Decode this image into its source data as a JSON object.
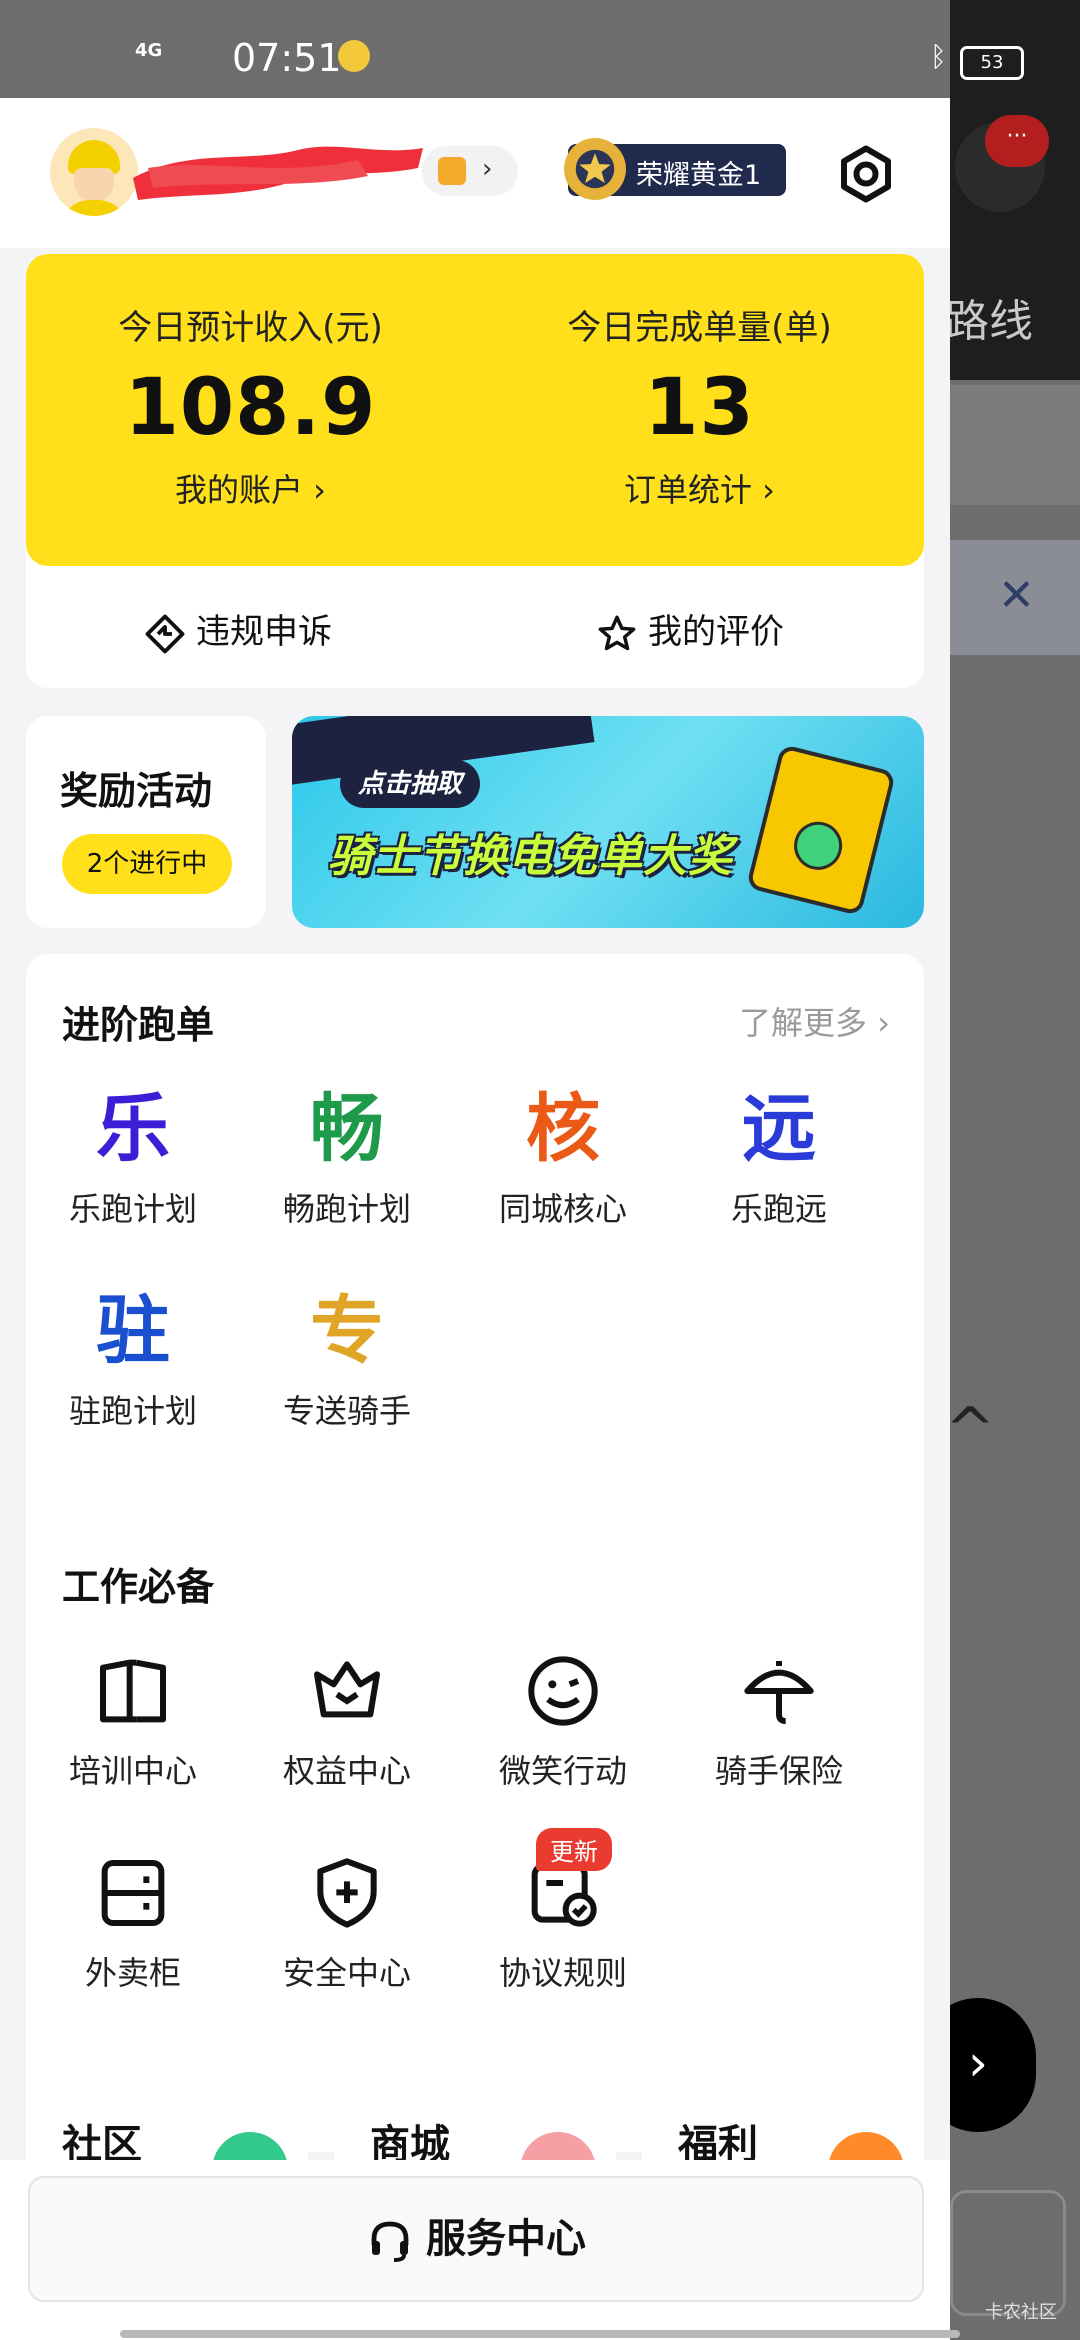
{
  "status_bar": {
    "network": "4G",
    "time": "07:51",
    "battery": "53"
  },
  "background_app": {
    "route_text": "路线",
    "bell_badge": "···",
    "watermark": "卡农社区"
  },
  "profile": {
    "level_badge": "荣耀黄金1"
  },
  "earnings": {
    "income_title": "今日预计收入(元)",
    "income_value": "108.9",
    "income_link": "我的账户 ›",
    "orders_title": "今日完成单量(单)",
    "orders_value": "13",
    "orders_link": "订单统计 ›",
    "appeal_label": "违规申诉",
    "rating_label": "我的评价"
  },
  "rewards": {
    "title": "奖励活动",
    "status": "2个进行中"
  },
  "banner": {
    "chip": "点击抽取",
    "headline": "骑士节换电免单大奖"
  },
  "advanced": {
    "title": "进阶跑单",
    "more": "了解更多 ›",
    "items": [
      {
        "glyph": "乐",
        "label": "乐跑计划",
        "color": "#3a1fd6"
      },
      {
        "glyph": "畅",
        "label": "畅跑计划",
        "color": "#1e9a4a"
      },
      {
        "glyph": "核",
        "label": "同城核心",
        "color": "#ea5a16"
      },
      {
        "glyph": "远",
        "label": "乐跑远",
        "color": "#2a3bd8"
      },
      {
        "glyph": "驻",
        "label": "驻跑计划",
        "color": "#1a4fd0"
      },
      {
        "glyph": "专",
        "label": "专送骑手",
        "color": "#e0a526"
      }
    ]
  },
  "essentials": {
    "title": "工作必备",
    "items": [
      {
        "icon": "book-icon",
        "label": "培训中心"
      },
      {
        "icon": "crown-icon",
        "label": "权益中心"
      },
      {
        "icon": "smile-wink-icon",
        "label": "微笑行动"
      },
      {
        "icon": "umbrella-icon",
        "label": "骑手保险"
      },
      {
        "icon": "locker-icon",
        "label": "外卖柜"
      },
      {
        "icon": "shield-plus-icon",
        "label": "安全中心"
      },
      {
        "icon": "document-check-icon",
        "label": "协议规则",
        "badge": "更新"
      }
    ]
  },
  "bottom_cards": [
    "社区",
    "商城",
    "福利"
  ],
  "service": {
    "label": "服务中心"
  }
}
